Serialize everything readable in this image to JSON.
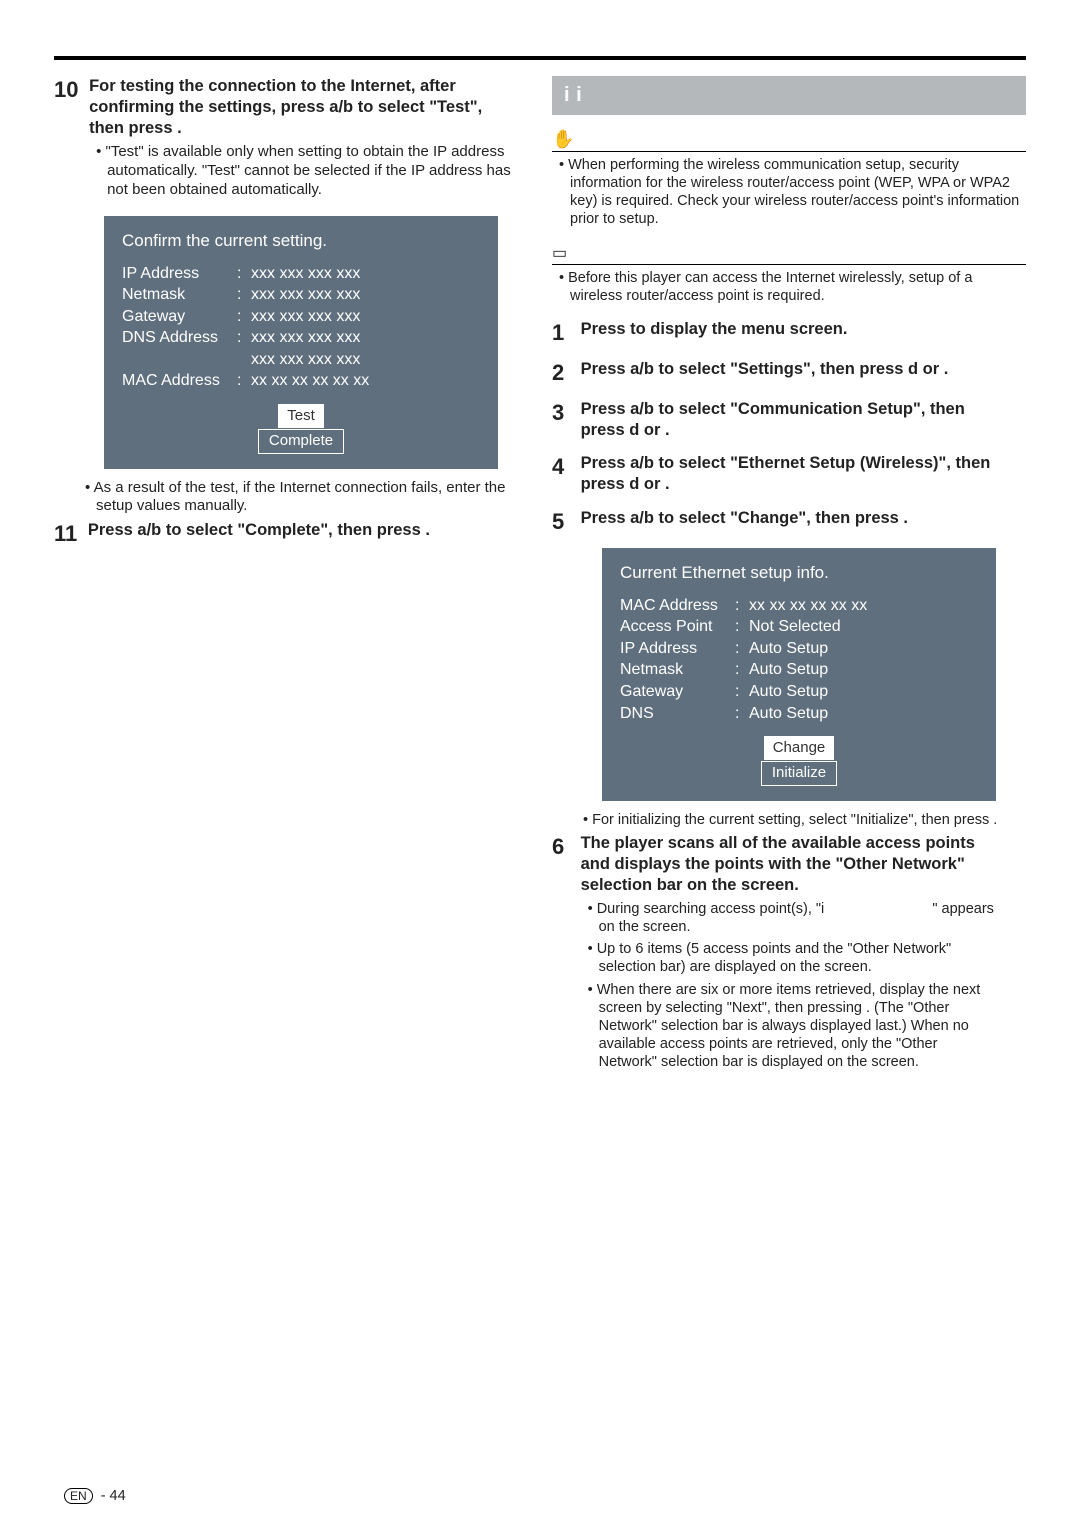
{
  "left": {
    "step10": {
      "num": "10",
      "bold": "For testing the connection to the Internet, after confirming the settings, press a/b to select \"Test\", then press        .",
      "bullet1": "\"Test\" is available only when setting to obtain the IP address automatically. \"Test\" cannot be selected if the IP address has not been obtained automatically.",
      "bullet2": "As a result of the test, if the Internet connection fails, enter the setup values manually."
    },
    "screen1": {
      "title": "Confirm the current setting.",
      "rows": [
        {
          "k": "IP Address",
          "v": "xxx xxx xxx xxx"
        },
        {
          "k": "Netmask",
          "v": "xxx xxx xxx xxx"
        },
        {
          "k": "Gateway",
          "v": "xxx xxx xxx xxx"
        },
        {
          "k": "DNS Address",
          "v": "xxx xxx xxx xxx"
        },
        {
          "k": "",
          "v": "xxx xxx xxx xxx"
        },
        {
          "k": "MAC Address",
          "v": "xx xx xx xx xx xx"
        }
      ],
      "btn1": "Test",
      "btn2": "Complete"
    },
    "step11": {
      "num": "11",
      "bold": "Press a/b to select \"Complete\", then press        ."
    }
  },
  "right": {
    "heading": "i  i",
    "cautionLabel": "",
    "caution1": "When performing the wireless communication setup, security information for the wireless router/access point (WEP, WPA or WPA2 key) is required. Check your wireless router/access point's information prior to setup.",
    "noteLabel": "",
    "note1": "Before this player can access the Internet wirelessly, setup of a wireless router/access point is required.",
    "steps": {
      "s1": {
        "num": "1",
        "text": "Press            to display the menu screen."
      },
      "s2": {
        "num": "2",
        "text": "Press a/b to select \"Settings\", then press d or        ."
      },
      "s3": {
        "num": "3",
        "text": "Press a/b to select \"Communication Setup\", then press d or        ."
      },
      "s4": {
        "num": "4",
        "text": "Press a/b to select \"Ethernet Setup (Wireless)\", then press d or        ."
      },
      "s5": {
        "num": "5",
        "text": "Press a/b to select \"Change\", then press        ."
      },
      "s6_num": "6",
      "s6_title": "The player scans all of the available access points and displays the points with the \"Other Network\" selection bar on the screen.",
      "s6_b1a": "During searching access point(s), \"i",
      "s6_b1b": "\" appears on the screen.",
      "s6_b2": "Up to 6 items (5 access points and the \"Other Network\" selection bar) are displayed on the screen.",
      "s6_b3": "When there are six or more items retrieved, display the next screen by selecting \"Next\", then pressing        . (The \"Other Network\" selection bar is always displayed last.) When no available access points are retrieved, only the \"Other Network\" selection bar is displayed on the screen."
    },
    "screen2": {
      "title": "Current Ethernet setup info.",
      "rows": [
        {
          "k": "MAC Address",
          "v": "xx xx xx xx xx xx"
        },
        {
          "k": "Access Point",
          "v": "Not Selected"
        },
        {
          "k": "IP Address",
          "v": "Auto Setup"
        },
        {
          "k": "Netmask",
          "v": "Auto Setup"
        },
        {
          "k": "Gateway",
          "v": "Auto Setup"
        },
        {
          "k": "DNS",
          "v": "Auto Setup"
        }
      ],
      "btn1": "Change",
      "btn2": "Initialize"
    },
    "postScreenBullet": "For initializing the current setting, select \"Initialize\", then press         ."
  },
  "footer": {
    "en": "EN",
    "page": "- 44"
  }
}
